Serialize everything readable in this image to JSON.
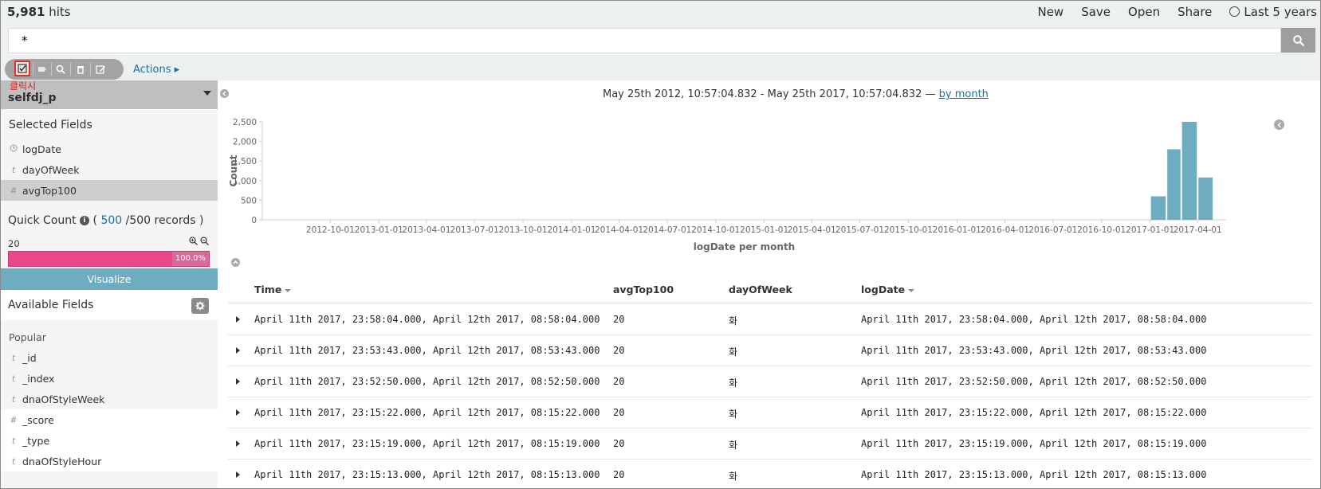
{
  "header": {
    "hits_count": "5,981",
    "hits_label": "hits",
    "nav": [
      "New",
      "Save",
      "Open",
      "Share"
    ],
    "time_range": "Last 5 years"
  },
  "search": {
    "query": "*"
  },
  "toolbar": {
    "actions_label": "Actions",
    "annotation": "클릭시"
  },
  "sidebar": {
    "index_name": "selfdj_p",
    "selected_title": "Selected Fields",
    "selected_fields": [
      {
        "type": "clock-icon",
        "name": "logDate"
      },
      {
        "type": "t",
        "name": "dayOfWeek"
      },
      {
        "type": "#",
        "name": "avgTop100"
      }
    ],
    "quick_count": {
      "label": "Quick Count",
      "open": "(",
      "shown": "500",
      "total": "/500 records )"
    },
    "quick_value": "20",
    "quick_pct": "100.0%",
    "visualize": "Visualize",
    "available_title": "Available Fields",
    "popular_title": "Popular",
    "available_fields": [
      {
        "type": "t",
        "name": "_id"
      },
      {
        "type": "t",
        "name": "_index"
      },
      {
        "type": "t",
        "name": "dnaOfStyleWeek"
      },
      {
        "type": "#",
        "name": "_score"
      },
      {
        "type": "t",
        "name": "_type"
      },
      {
        "type": "t",
        "name": "dnaOfStyleHour"
      }
    ]
  },
  "histogram": {
    "range_text": "May 25th 2012, 10:57:04.832 - May 25th 2017, 10:57:04.832 —",
    "interval_link": "by month"
  },
  "chart_data": {
    "type": "bar",
    "xlabel": "logDate per month",
    "ylabel": "Count",
    "ylim": [
      0,
      2500
    ],
    "yticks": [
      "0",
      "500",
      "1,000",
      "1,500",
      "2,000",
      "2,500"
    ],
    "ytick_values": [
      0,
      500,
      1000,
      1500,
      2000,
      2500
    ],
    "xticks": [
      "2012-10-01",
      "2013-01-01",
      "2013-04-01",
      "2013-07-01",
      "2013-10-01",
      "2014-01-01",
      "2014-04-01",
      "2014-07-01",
      "2014-10-01",
      "2015-01-01",
      "2015-04-01",
      "2015-07-01",
      "2015-10-01",
      "2016-01-01",
      "2016-04-01",
      "2016-07-01",
      "2016-10-01",
      "2017-01-01",
      "2017-04-01"
    ],
    "xlim": [
      "2012-05-25",
      "2017-05-25"
    ],
    "bars": [
      {
        "x": "2017-01-01",
        "value": 600
      },
      {
        "x": "2017-02-01",
        "value": 1800
      },
      {
        "x": "2017-03-01",
        "value": 2500
      },
      {
        "x": "2017-04-01",
        "value": 1080
      }
    ],
    "color": "#6eadc1"
  },
  "table": {
    "columns": [
      "Time",
      "avgTop100",
      "dayOfWeek",
      "logDate"
    ],
    "rows": [
      [
        "April 11th 2017, 23:58:04.000, April 12th 2017, 08:58:04.000",
        "20",
        "화",
        "April 11th 2017, 23:58:04.000, April 12th 2017, 08:58:04.000"
      ],
      [
        "April 11th 2017, 23:53:43.000, April 12th 2017, 08:53:43.000",
        "20",
        "화",
        "April 11th 2017, 23:53:43.000, April 12th 2017, 08:53:43.000"
      ],
      [
        "April 11th 2017, 23:52:50.000, April 12th 2017, 08:52:50.000",
        "20",
        "화",
        "April 11th 2017, 23:52:50.000, April 12th 2017, 08:52:50.000"
      ],
      [
        "April 11th 2017, 23:15:22.000, April 12th 2017, 08:15:22.000",
        "20",
        "화",
        "April 11th 2017, 23:15:22.000, April 12th 2017, 08:15:22.000"
      ],
      [
        "April 11th 2017, 23:15:19.000, April 12th 2017, 08:15:19.000",
        "20",
        "화",
        "April 11th 2017, 23:15:19.000, April 12th 2017, 08:15:19.000"
      ],
      [
        "April 11th 2017, 23:15:13.000, April 12th 2017, 08:15:13.000",
        "20",
        "화",
        "April 11th 2017, 23:15:13.000, April 12th 2017, 08:15:13.000"
      ]
    ]
  }
}
